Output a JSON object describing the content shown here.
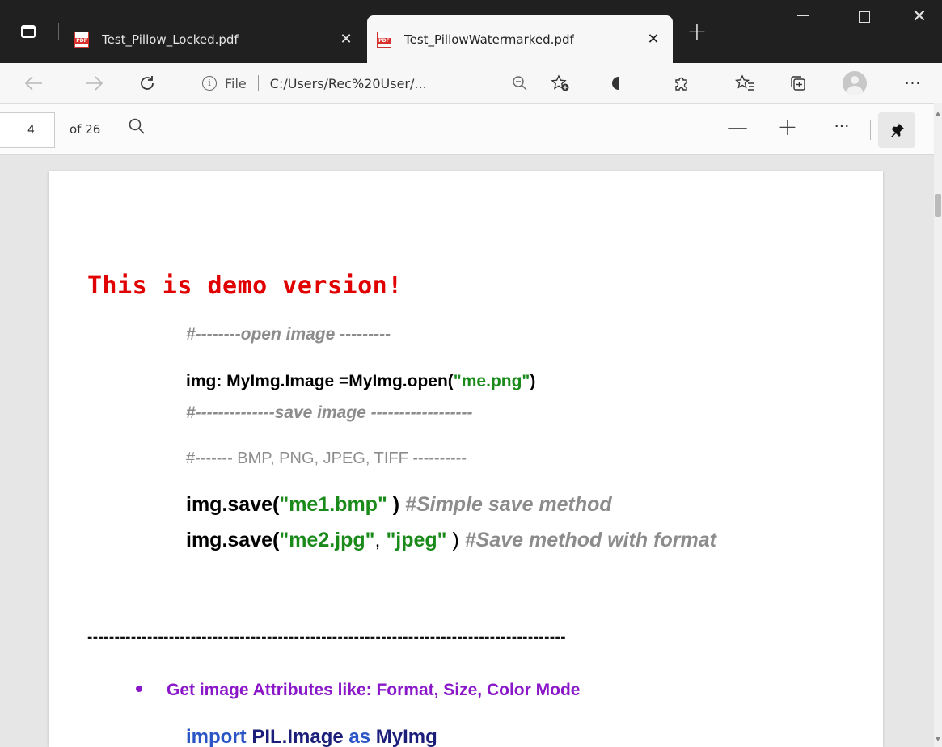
{
  "tabs": [
    {
      "title": "Test_Pillow_Locked.pdf",
      "active": false
    },
    {
      "title": "Test_PillowWatermarked.pdf",
      "active": true
    }
  ],
  "address": {
    "file_label": "File",
    "url": "C:/Users/Rec%20User/..."
  },
  "pdf_toolbar": {
    "page_number": "4",
    "page_count": "of 26"
  },
  "document": {
    "demo_banner": "This is demo version!",
    "comment_open": "#--------open  image ---------",
    "code_open_prefix": "img: MyImg.Image =MyImg.open(",
    "code_open_str": "\"me.png\"",
    "code_open_suffix": ")",
    "comment_save": "#--------------save  image ------------------",
    "comment_formats": "#------- BMP, PNG, JPEG, TIFF ----------",
    "save1_prefix": "img.save(",
    "save1_str": "\"me1.bmp\"",
    "save1_suffix": "  )",
    "save1_comment": " #Simple save method",
    "save2_prefix": "img.save(",
    "save2_str1": "\"me2.jpg\"",
    "save2_comma": ", ",
    "save2_str2": "\"jpeg\"",
    "save2_suffix": " ) ",
    "save2_comment": "#Save method with format",
    "separator": "----------------------------------------------------------------------------------------",
    "bullet_text": "Get image Attributes like: Format, Size, Color Mode",
    "import_kw": "import",
    "import_mod": " PIL.Image ",
    "import_as": "as",
    "import_alias": " MyImg"
  },
  "colors": {
    "tabstrip": "#202020",
    "demo_red": "#e00000",
    "string_green": "#1a8a1a",
    "comment_gray": "#8c8c8c",
    "bullet_purple": "#8a17c8"
  }
}
